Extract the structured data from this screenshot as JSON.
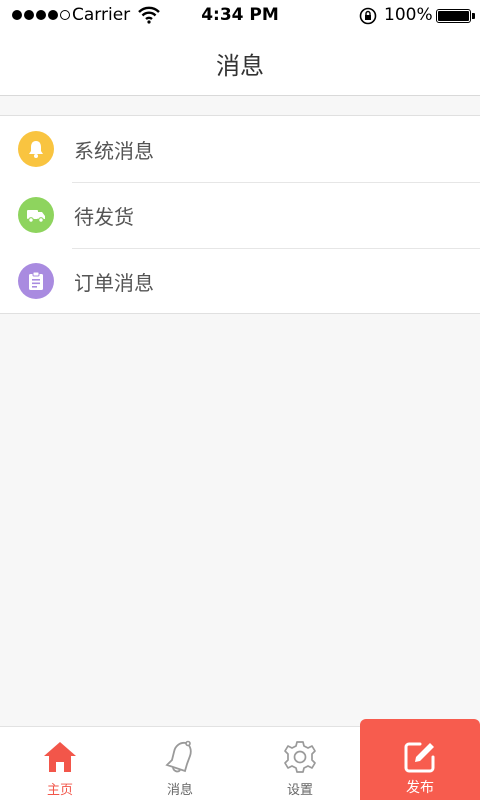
{
  "status_bar": {
    "carrier": "Carrier",
    "time": "4:34 PM",
    "battery": "100%"
  },
  "nav": {
    "title": "消息"
  },
  "list": {
    "items": [
      {
        "label": "系统消息",
        "icon": "bell-icon",
        "color": "#f9c440"
      },
      {
        "label": "待发货",
        "icon": "truck-icon",
        "color": "#8ed45e"
      },
      {
        "label": "订单消息",
        "icon": "clipboard-icon",
        "color": "#a98be0"
      }
    ]
  },
  "tab_bar": {
    "tabs": [
      {
        "label": "主页",
        "icon": "home-icon",
        "active": true
      },
      {
        "label": "消息",
        "icon": "bell-outline-icon",
        "active": false
      },
      {
        "label": "设置",
        "icon": "gear-icon",
        "active": false
      },
      {
        "label": "发布",
        "icon": "edit-icon",
        "active": false
      }
    ]
  },
  "colors": {
    "accent": "#f75c4e",
    "active_tab": "#f2564a"
  }
}
